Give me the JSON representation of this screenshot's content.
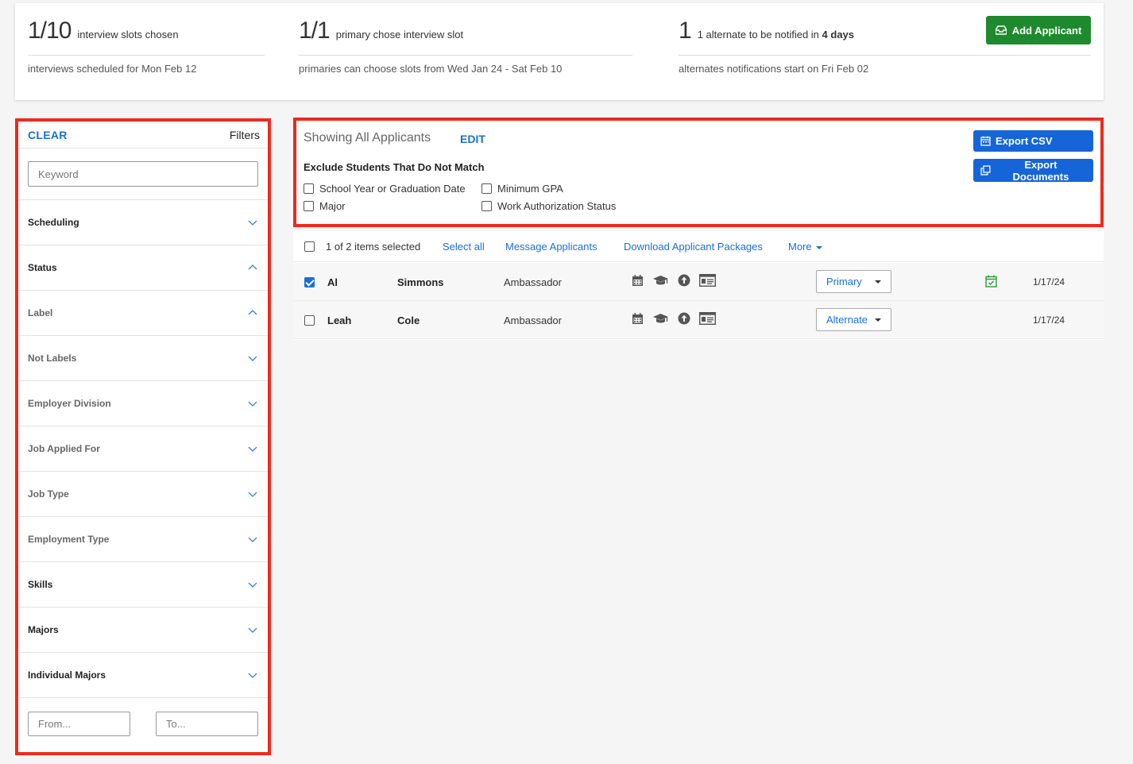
{
  "stats": {
    "slots": {
      "big": "1/10",
      "label": "interview slots chosen",
      "sub": "interviews scheduled for Mon Feb 12"
    },
    "primary": {
      "big": "1/1",
      "label": "primary chose interview slot",
      "sub": "primaries can choose slots from Wed Jan 24 - Sat Feb 10"
    },
    "alternate": {
      "big": "1",
      "label_pre": "1 alternate to be notified in",
      "label_bold": "4 days",
      "sub": "alternates notifications start on Fri Feb 02"
    }
  },
  "add_applicant_label": "Add Applicant",
  "sidebar": {
    "clear_label": "CLEAR",
    "title": "Filters",
    "keyword_placeholder": "Keyword",
    "facets": [
      {
        "label": "Scheduling",
        "expanded": false,
        "muted": false
      },
      {
        "label": "Status",
        "expanded": true,
        "muted": false
      },
      {
        "label": "Label",
        "expanded": true,
        "muted": true
      },
      {
        "label": "Not Labels",
        "expanded": false,
        "muted": true
      },
      {
        "label": "Employer Division",
        "expanded": false,
        "muted": true
      },
      {
        "label": "Job Applied For",
        "expanded": false,
        "muted": true
      },
      {
        "label": "Job Type",
        "expanded": false,
        "muted": true
      },
      {
        "label": "Employment Type",
        "expanded": false,
        "muted": true
      },
      {
        "label": "Skills",
        "expanded": false,
        "muted": false
      },
      {
        "label": "Majors",
        "expanded": false,
        "muted": false
      },
      {
        "label": "Individual Majors",
        "expanded": false,
        "muted": false
      }
    ],
    "from_placeholder": "From...",
    "to_placeholder": "To..."
  },
  "panel": {
    "title": "Showing All Applicants",
    "edit_label": "EDIT",
    "exclude_title": "Exclude Students That Do Not Match",
    "checkboxes": {
      "school_year": "School Year or Graduation Date",
      "min_gpa": "Minimum GPA",
      "major": "Major",
      "work_auth": "Work Authorization Status"
    },
    "export_csv_label": "Export CSV",
    "export_docs_label": "Export Documents"
  },
  "toolbar": {
    "selected_text": "1 of 2 items selected",
    "select_all": "Select all",
    "message": "Message Applicants",
    "download": "Download Applicant Packages",
    "more": "More"
  },
  "applicants": [
    {
      "first": "Al",
      "last": "Simmons",
      "title": "Ambassador",
      "status": "Primary",
      "date": "1/17/24",
      "checked": true,
      "scheduled": true
    },
    {
      "first": "Leah",
      "last": "Cole",
      "title": "Ambassador",
      "status": "Alternate",
      "date": "1/17/24",
      "checked": false,
      "scheduled": false
    }
  ],
  "colors": {
    "accent_blue": "#1a6fd6",
    "button_blue": "#1565d8",
    "green": "#1e8a2e",
    "highlight_red": "#f0291c"
  },
  "icons": [
    "inbox-icon",
    "calendar-icon",
    "graduation-cap-icon",
    "upload-circle-icon",
    "id-card-icon",
    "copy-icon",
    "calendar-check-icon",
    "chevron-down-icon",
    "chevron-up-icon"
  ]
}
